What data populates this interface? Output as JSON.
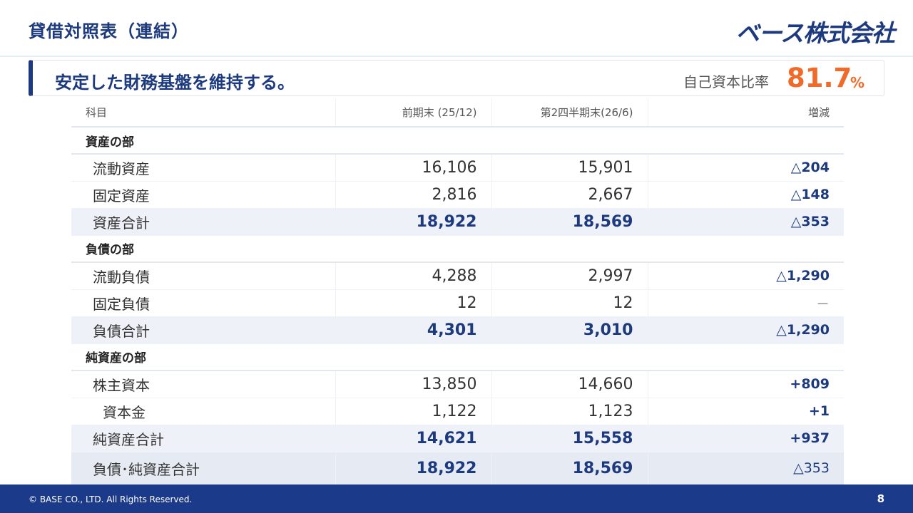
{
  "header": {
    "title": "貸借対照表（連結）",
    "logo": "ベース株式会社"
  },
  "banner": {
    "headline": "安定した財務基盤を維持する。",
    "ratio_label": "自己資本比率",
    "ratio_value": "81.7",
    "ratio_unit": "%"
  },
  "table": {
    "columns": [
      "科目",
      "前期末 (25/12)",
      "第2四半期末(26/6)",
      "増減"
    ],
    "rows": [
      {
        "type": "section",
        "label": "資産の部"
      },
      {
        "type": "item",
        "label": "流動資産",
        "prev": "16,106",
        "curr": "15,901",
        "change": "△204"
      },
      {
        "type": "item",
        "label": "固定資産",
        "prev": "2,816",
        "curr": "2,667",
        "change": "△148"
      },
      {
        "type": "total",
        "label": "資産合計",
        "prev": "18,922",
        "curr": "18,569",
        "change": "△353"
      },
      {
        "type": "section",
        "label": "負債の部"
      },
      {
        "type": "item",
        "label": "流動負債",
        "prev": "4,288",
        "curr": "2,997",
        "change": "△1,290"
      },
      {
        "type": "item",
        "label": "固定負債",
        "prev": "12",
        "curr": "12",
        "change": "－"
      },
      {
        "type": "total",
        "label": "負債合計",
        "prev": "4,301",
        "curr": "3,010",
        "change": "△1,290"
      },
      {
        "type": "section",
        "label": "純資産の部"
      },
      {
        "type": "item",
        "label": "株主資本",
        "prev": "13,850",
        "curr": "14,660",
        "change": "+809"
      },
      {
        "type": "item",
        "label": "資本金",
        "prev": "1,122",
        "curr": "1,123",
        "change": "+1"
      },
      {
        "type": "total",
        "label": "純資産合計",
        "prev": "14,621",
        "curr": "15,558",
        "change": "+937"
      },
      {
        "type": "grand",
        "label": "負債･純資産合計",
        "prev": "18,922",
        "curr": "18,569",
        "change": "△353"
      }
    ]
  },
  "footer": {
    "copyright": "© BASE CO., LTD. All Rights Reserved.",
    "page_number": "8"
  },
  "colors": {
    "brand_navy": "#1c3a7d",
    "accent_orange": "#f06a2a",
    "total_row_bg": "#eef2f8",
    "footer_bg": "#1c3a8a"
  }
}
